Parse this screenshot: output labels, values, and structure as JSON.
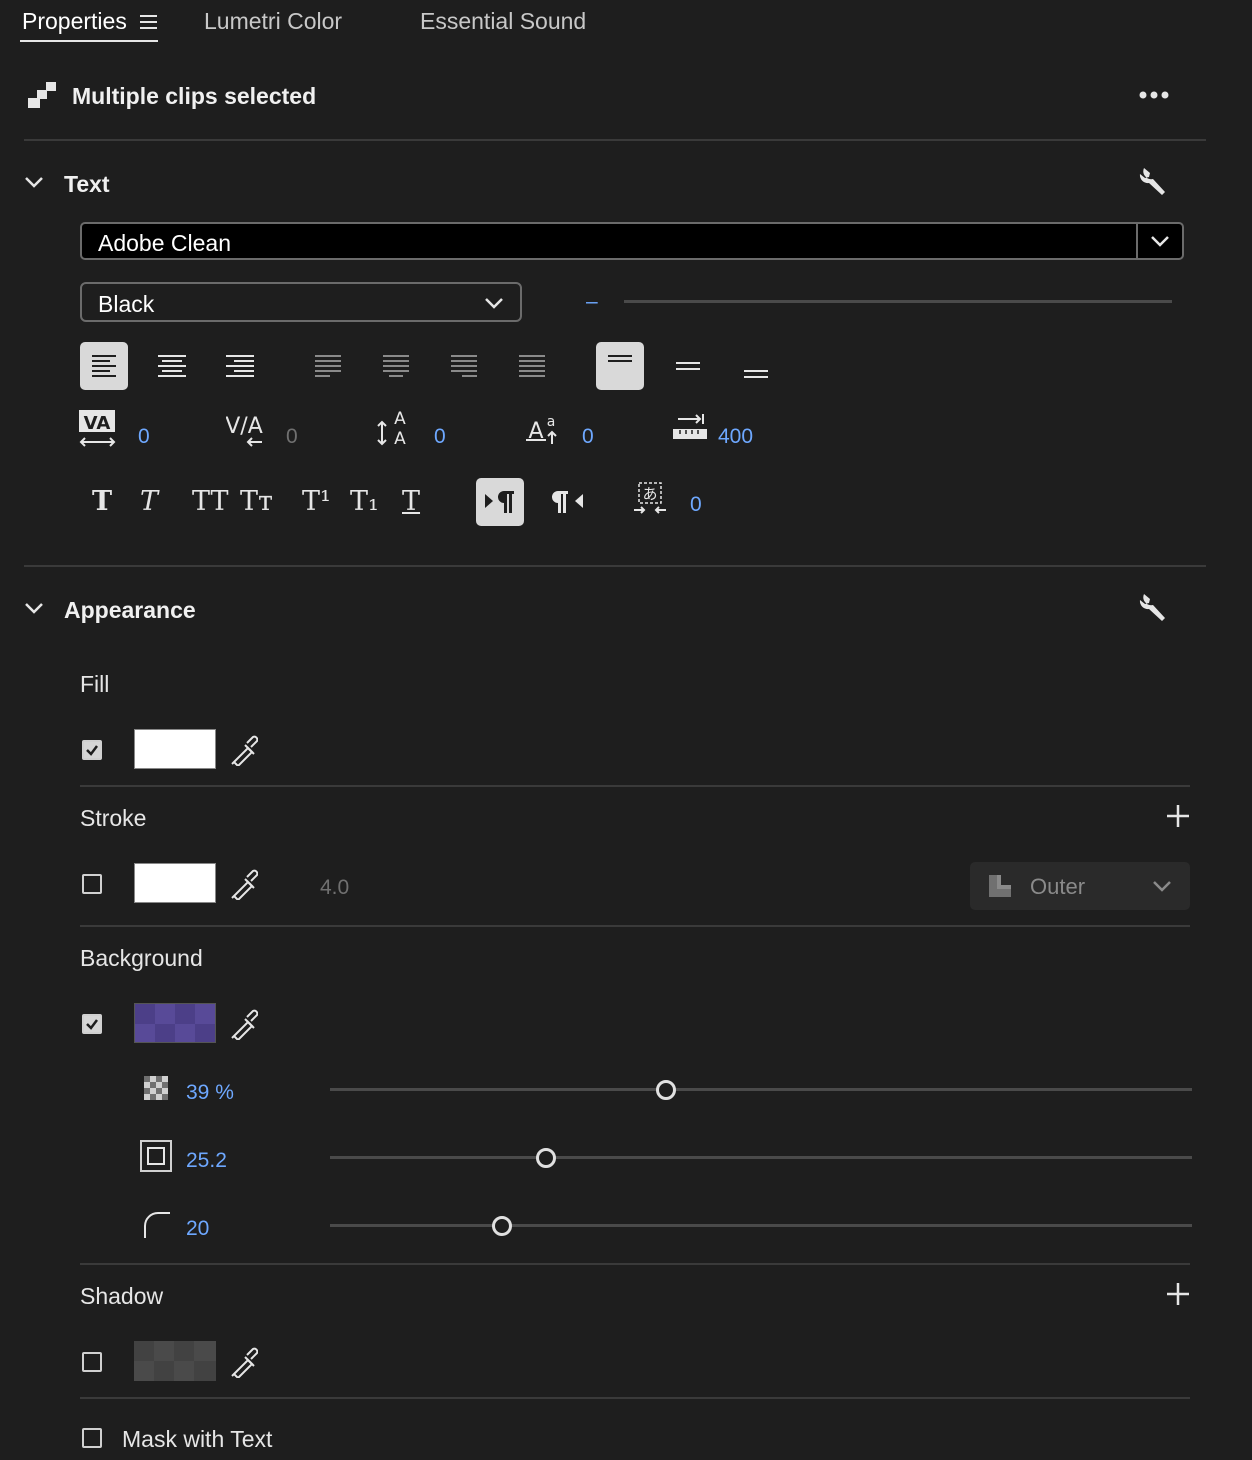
{
  "tabs": [
    {
      "label": "Properties",
      "active": true
    },
    {
      "label": "Lumetri Color",
      "active": false
    },
    {
      "label": "Essential Sound",
      "active": false
    }
  ],
  "header": {
    "title": "Multiple clips selected"
  },
  "text_section": {
    "title": "Text",
    "font_family": "Adobe Clean",
    "font_style": "Black",
    "font_size_placeholder": "–",
    "metrics": {
      "kerning": "0",
      "tracking": "0",
      "leading": "0",
      "baseline_shift": "0",
      "tab_width": "400"
    },
    "tsume": "0",
    "style_glyphs": {
      "bold": "T",
      "italic": "T",
      "all_caps": "TT",
      "small_caps": "Tт",
      "superscript": "T¹",
      "subscript": "T₁",
      "underline": "T"
    }
  },
  "appearance_section": {
    "title": "Appearance",
    "fill": {
      "label": "Fill",
      "enabled": true,
      "color": "#ffffff"
    },
    "stroke": {
      "label": "Stroke",
      "enabled": false,
      "color": "#ffffff",
      "width": "4.0",
      "position": "Outer"
    },
    "background": {
      "label": "Background",
      "enabled": true,
      "color": "#5a4b9a",
      "opacity_label": "39 %",
      "opacity": 0.39,
      "size_label": "25.2",
      "size_level": 0.25,
      "corner_label": "20",
      "corner_level": 0.2
    },
    "shadow": {
      "label": "Shadow",
      "enabled": false,
      "color": "#4a4a4a"
    },
    "mask_with_text": {
      "label": "Mask with Text",
      "enabled": false
    }
  },
  "colors": {
    "accent_value": "#6ea8ff",
    "panel_bg": "#1e1e1e"
  }
}
